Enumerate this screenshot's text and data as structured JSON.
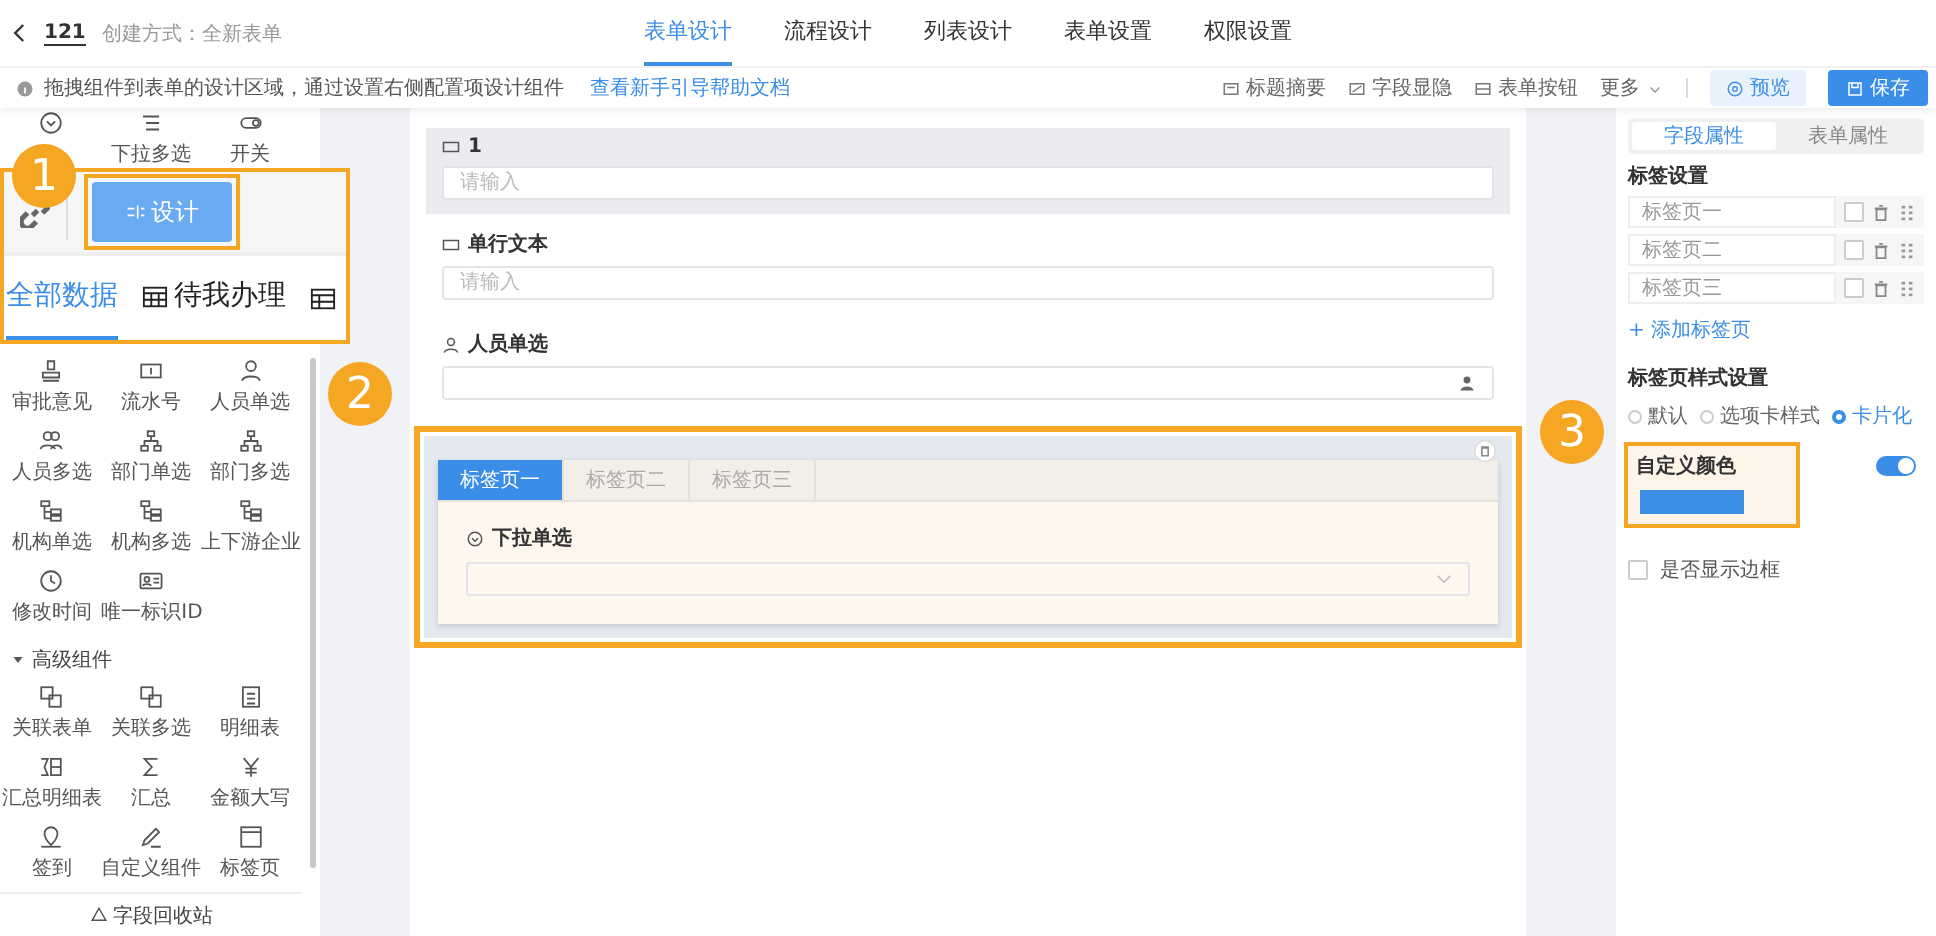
{
  "header": {
    "form_name": "121",
    "create_method": "创建方式：全新表单",
    "tabs": [
      {
        "label": "表单设计",
        "selected": true
      },
      {
        "label": "流程设计",
        "selected": false
      },
      {
        "label": "列表设计",
        "selected": false
      },
      {
        "label": "表单设置",
        "selected": false
      },
      {
        "label": "权限设置",
        "selected": false
      }
    ]
  },
  "notice": {
    "text": "拖拽组件到表单的设计区域，通过设置右侧配置项设计组件",
    "link": "查看新手引导帮助文档"
  },
  "toolbar": {
    "actions": [
      "标题摘要",
      "字段显隐",
      "表单按钮"
    ],
    "more": "更多",
    "preview": "预览",
    "save": "保存"
  },
  "palette": {
    "top_items": [
      {
        "label": "下拉多选"
      },
      {
        "label": "开关"
      }
    ],
    "basic_items": [
      {
        "label": "审批意见"
      },
      {
        "label": "流水号"
      },
      {
        "label": "人员单选"
      },
      {
        "label": "人员多选"
      },
      {
        "label": "部门单选"
      },
      {
        "label": "部门多选"
      },
      {
        "label": "机构单选"
      },
      {
        "label": "机构多选"
      },
      {
        "label": "上下游企业"
      },
      {
        "label": "修改时间"
      },
      {
        "label": "唯一标识ID"
      }
    ],
    "advanced": {
      "title": "高级组件",
      "expanded": true,
      "items": [
        {
          "label": "关联表单"
        },
        {
          "label": "关联多选"
        },
        {
          "label": "明细表"
        },
        {
          "label": "汇总明细表"
        },
        {
          "label": "汇总"
        },
        {
          "label": "金额大写"
        },
        {
          "label": "签到"
        },
        {
          "label": "自定义组件"
        },
        {
          "label": "标签页"
        }
      ]
    },
    "recycle": "字段回收站"
  },
  "callout": {
    "button": "设计",
    "tabs": [
      {
        "label": "全部数据",
        "selected": true
      },
      {
        "label": "待我办理",
        "selected": false
      }
    ]
  },
  "form_fields": [
    {
      "kind": "text",
      "label": "1",
      "placeholder": "请输入",
      "selected": true
    },
    {
      "kind": "text",
      "label": "单行文本",
      "placeholder": "请输入",
      "selected": false
    },
    {
      "kind": "person",
      "label": "人员单选",
      "selected": false
    },
    {
      "kind": "tabs",
      "selected": false,
      "tabs": [
        {
          "label": "标签页一",
          "selected": true
        },
        {
          "label": "标签页二",
          "selected": false
        },
        {
          "label": "标签页三",
          "selected": false
        }
      ],
      "field": {
        "label": "下拉单选"
      }
    }
  ],
  "properties": {
    "tabs": [
      {
        "label": "字段属性",
        "selected": true
      },
      {
        "label": "表单属性",
        "selected": false
      }
    ],
    "tab_settings_title": "标签设置",
    "tab_rows": [
      {
        "name": "标签页一",
        "checked": false
      },
      {
        "name": "标签页二",
        "checked": false
      },
      {
        "name": "标签页三",
        "checked": false
      }
    ],
    "add_tab": "+ 添加标签页",
    "style_title": "标签页样式设置",
    "styles": [
      {
        "label": "默认",
        "selected": false
      },
      {
        "label": "选项卡样式",
        "selected": false
      },
      {
        "label": "卡片化",
        "selected": true
      }
    ],
    "custom_color": {
      "label": "自定义颜色",
      "on": true,
      "color": "#3d8fe6"
    },
    "border_option": {
      "label": "是否显示边框",
      "checked": false
    }
  },
  "badges": [
    "1",
    "2",
    "3"
  ]
}
